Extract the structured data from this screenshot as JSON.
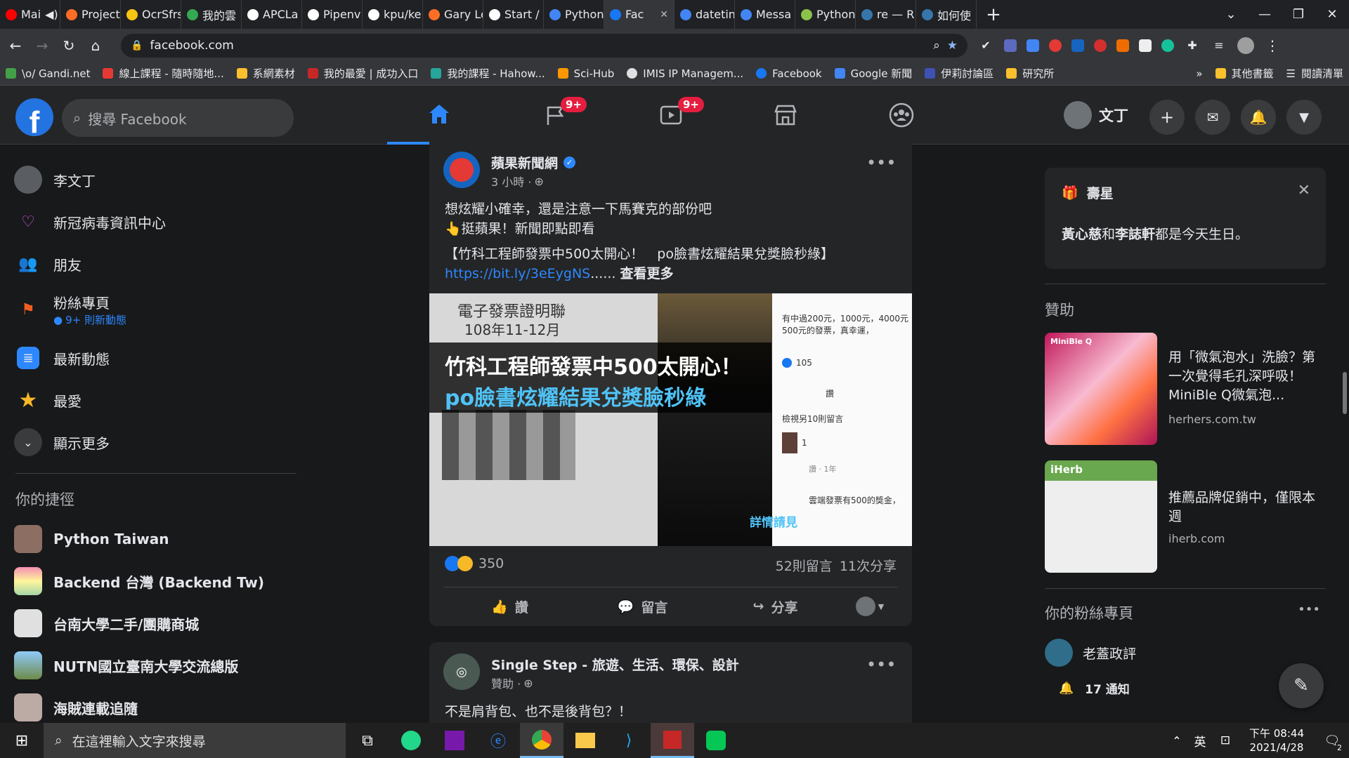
{
  "browser": {
    "tabs": [
      {
        "label": "Mai",
        "color": "#ff0000"
      },
      {
        "label": "Project",
        "color": "#fc6d26"
      },
      {
        "label": "OcrSfrs",
        "color": "#f9c513"
      },
      {
        "label": "我的雲",
        "color": "#34a853"
      },
      {
        "label": "APCLa",
        "color": "#ffffff"
      },
      {
        "label": "Pipenv",
        "color": "#ffffff"
      },
      {
        "label": "kpu/ke",
        "color": "#ffffff"
      },
      {
        "label": "Gary Le",
        "color": "#fc6d26"
      },
      {
        "label": "Start /",
        "color": "#ffffff"
      },
      {
        "label": "Python",
        "color": "#4285f4"
      },
      {
        "label": "Fac",
        "color": "#1877f2",
        "active": true
      },
      {
        "label": "datetin",
        "color": "#4285f4"
      },
      {
        "label": "Messa",
        "color": "#4285f4"
      },
      {
        "label": "Python",
        "color": "#8bc34a"
      },
      {
        "label": "re — R",
        "color": "#3776ab"
      },
      {
        "label": "如何使",
        "color": "#3776ab"
      }
    ],
    "url": "facebook.com",
    "bookmarks": [
      {
        "label": "\\o/ Gandi.net",
        "color": "#43a047"
      },
      {
        "label": "線上課程 - 隨時隨地...",
        "color": "#e53935"
      },
      {
        "label": "系網素材",
        "color": "#fbc02d"
      },
      {
        "label": "我的最愛 | 成功入口",
        "color": "#c62828"
      },
      {
        "label": "我的課程 - Hahow...",
        "color": "#26a69a"
      },
      {
        "label": "Sci-Hub",
        "color": "#ff9800"
      },
      {
        "label": "IMIS IP Managem...",
        "color": "#e0e0e0"
      },
      {
        "label": "Facebook",
        "color": "#1877f2"
      },
      {
        "label": "Google 新聞",
        "color": "#4285f4"
      },
      {
        "label": "伊莉討論區",
        "color": "#3f51b5"
      },
      {
        "label": "研究所",
        "color": "#fbc02d"
      }
    ],
    "bookmarks_more": "»",
    "other_bookmarks": "其他書籤",
    "reading_list": "閱讀清單"
  },
  "fb": {
    "logo": "f",
    "search_placeholder": "搜尋 Facebook",
    "nav_badge_pages": "9+",
    "nav_badge_watch": "9+",
    "user_name": "文丁",
    "left": {
      "items": [
        {
          "label": "李文丁"
        },
        {
          "label": "新冠病毒資訊中心"
        },
        {
          "label": "朋友"
        },
        {
          "label": "粉絲專頁",
          "sub": "9+ 則新動態"
        },
        {
          "label": "最新動態"
        },
        {
          "label": "最愛"
        },
        {
          "label": "顯示更多"
        }
      ],
      "shortcuts_title": "你的捷徑",
      "shortcuts": [
        "Python Taiwan",
        "Backend 台灣 (Backend Tw)",
        "台南大學二手/團購商城",
        "NUTN國立臺南大學交流總版",
        "海賊連載追隨"
      ]
    },
    "post1": {
      "page_name": "蘋果新聞網",
      "time": "3 小時 ·",
      "text1": "想炫耀小確幸，還是注意一下馬賽克的部份吧",
      "text2": "👆挺蘋果！新聞即點即看",
      "text3": "【竹科工程師發票中500太開心！　po臉書炫耀結果兌獎臉秒綠】",
      "link": "https://bit.ly/3eEygNS",
      "ellipsis": "......",
      "see_more": "查看更多",
      "image_title1": "竹科工程師發票中500太開心！",
      "image_title2": "po臉書炫耀結果兌獎臉秒綠",
      "image_receipt_head": "電子發票證明聯",
      "image_receipt_date": "108年11-12月",
      "image_detail": "詳情請見",
      "image_side_text": "有中過200元，1000元，4000元 500元的發票，真幸運，",
      "image_like_count": "105",
      "image_like_btn": "讚",
      "image_comments": "檢視另10則留言",
      "image_reply1": "1",
      "image_reply_time": "讚 · 1年",
      "image_reply_text": "雲端發票有500的獎金，",
      "reactions": "350",
      "comments": "52則留言",
      "shares": "11次分享",
      "like": "讚",
      "comment": "留言",
      "share": "分享"
    },
    "post2": {
      "page_name": "Single Step - 旅遊、生活、環保、設計",
      "sponsored": "贊助 ·",
      "text": "不是肩背包、也不是後背包？！"
    },
    "right": {
      "birthday_title": "壽星",
      "birthday_name1": "黃心慈",
      "birthday_and": "和",
      "birthday_name2": "李誌軒",
      "birthday_suffix": "都是今天生日。",
      "sponsored_title": "贊助",
      "ads": [
        {
          "text": "用「微氣泡水」洗臉？第一次覺得毛孔深呼吸！MiniBle Q微氣泡...",
          "domain": "herhers.com.tw",
          "brand": "MiniBle Q"
        },
        {
          "text": "推薦品牌促銷中，僅限本週",
          "domain": "iherb.com",
          "brand": "iHerb"
        }
      ],
      "pages_title": "你的粉絲專頁",
      "page_name": "老蓋政評",
      "notifications": "17 通知"
    }
  },
  "taskbar": {
    "search_placeholder": "在這裡輸入文字來搜尋",
    "lang": "英",
    "time": "下午 08:44",
    "date": "2021/4/28",
    "notif_count": "2"
  },
  "colors": {
    "fb_blue": "#2d88ff",
    "badge_red": "#e41e3f",
    "bg": "#18191a",
    "card": "#242526"
  }
}
